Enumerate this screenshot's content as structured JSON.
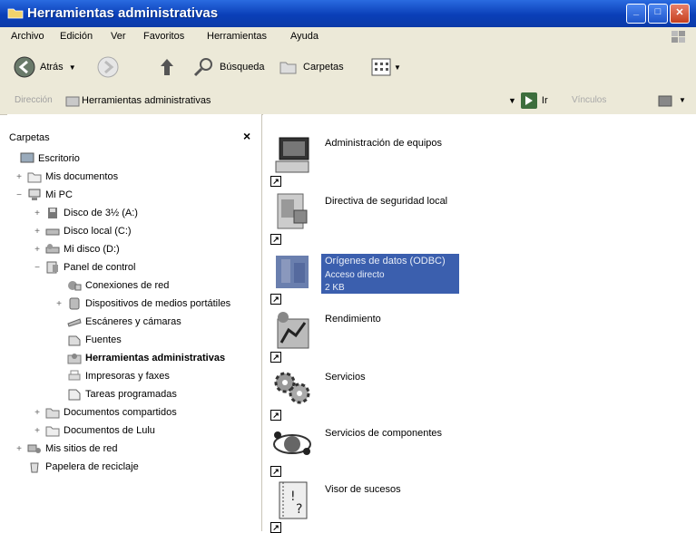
{
  "window": {
    "title": "Herramientas administrativas",
    "controls": {
      "minimize": "_",
      "maximize": "□",
      "close": "✕"
    }
  },
  "menu": {
    "items": [
      "Archivo",
      "Edición",
      "Ver",
      "Favoritos",
      "Herramientas",
      "Ayuda"
    ]
  },
  "toolbar": {
    "back_label": "Atrás",
    "search_label": "Búsqueda",
    "folders_label": "Carpetas"
  },
  "address": {
    "label": "Dirección",
    "value": "Herramientas administrativas",
    "go_label": "Ir",
    "links_label": "Vínculos"
  },
  "folders_pane": {
    "header": "Carpetas",
    "close": "×",
    "tree": [
      {
        "label": "Escritorio",
        "expander": "",
        "icon": "desktop-icon"
      },
      {
        "label": "Mis documentos",
        "expander": "+",
        "icon": "folder-icon"
      },
      {
        "label": "Mi PC",
        "expander": "−",
        "icon": "computer-icon"
      },
      {
        "label": "Disco de 3½ (A:)",
        "expander": "+",
        "icon": "floppy-icon"
      },
      {
        "label": "Disco local (C:)",
        "expander": "+",
        "icon": "drive-icon"
      },
      {
        "label": "Mi disco (D:)",
        "expander": "+",
        "icon": "drive-icon"
      },
      {
        "label": "Panel de control",
        "expander": "−",
        "icon": "control-panel-icon"
      },
      {
        "label": "Conexiones de red",
        "expander": "",
        "icon": "network-icon"
      },
      {
        "label": "Dispositivos de medios portátiles",
        "expander": "+",
        "icon": "device-icon"
      },
      {
        "label": "Escáneres y cámaras",
        "expander": "",
        "icon": "scanner-icon"
      },
      {
        "label": "Fuentes",
        "expander": "",
        "icon": "fonts-icon"
      },
      {
        "label": "Herramientas administrativas",
        "expander": "",
        "icon": "admin-tools-icon"
      },
      {
        "label": "Impresoras y faxes",
        "expander": "",
        "icon": "printer-icon"
      },
      {
        "label": "Tareas programadas",
        "expander": "",
        "icon": "tasks-icon"
      },
      {
        "label": "Documentos compartidos",
        "expander": "+",
        "icon": "folder-icon"
      },
      {
        "label": "Documentos de Lulu",
        "expander": "+",
        "icon": "folder-icon"
      },
      {
        "label": "Mis sitios de red",
        "expander": "+",
        "icon": "network-places-icon"
      },
      {
        "label": "Papelera de reciclaje",
        "expander": "",
        "icon": "recycle-bin-icon"
      }
    ]
  },
  "files": [
    {
      "name": "Administración de equipos",
      "icon": "computer-management-icon",
      "selected": false
    },
    {
      "name": "Directiva de seguridad local",
      "icon": "security-policy-icon",
      "selected": false
    },
    {
      "name": "Orígenes de datos (ODBC)",
      "line2": "Acceso directo",
      "line3": "2 KB",
      "icon": "odbc-icon",
      "selected": true
    },
    {
      "name": "Rendimiento",
      "icon": "performance-icon",
      "selected": false
    },
    {
      "name": "Servicios",
      "icon": "services-icon",
      "selected": false
    },
    {
      "name": "Servicios de componentes",
      "icon": "component-services-icon",
      "selected": false
    },
    {
      "name": "Visor de sucesos",
      "icon": "event-viewer-icon",
      "selected": false
    }
  ],
  "colors": {
    "title_bar": "#0a3fb8",
    "selection": "#3b5fae",
    "chrome": "#ece9d8"
  }
}
